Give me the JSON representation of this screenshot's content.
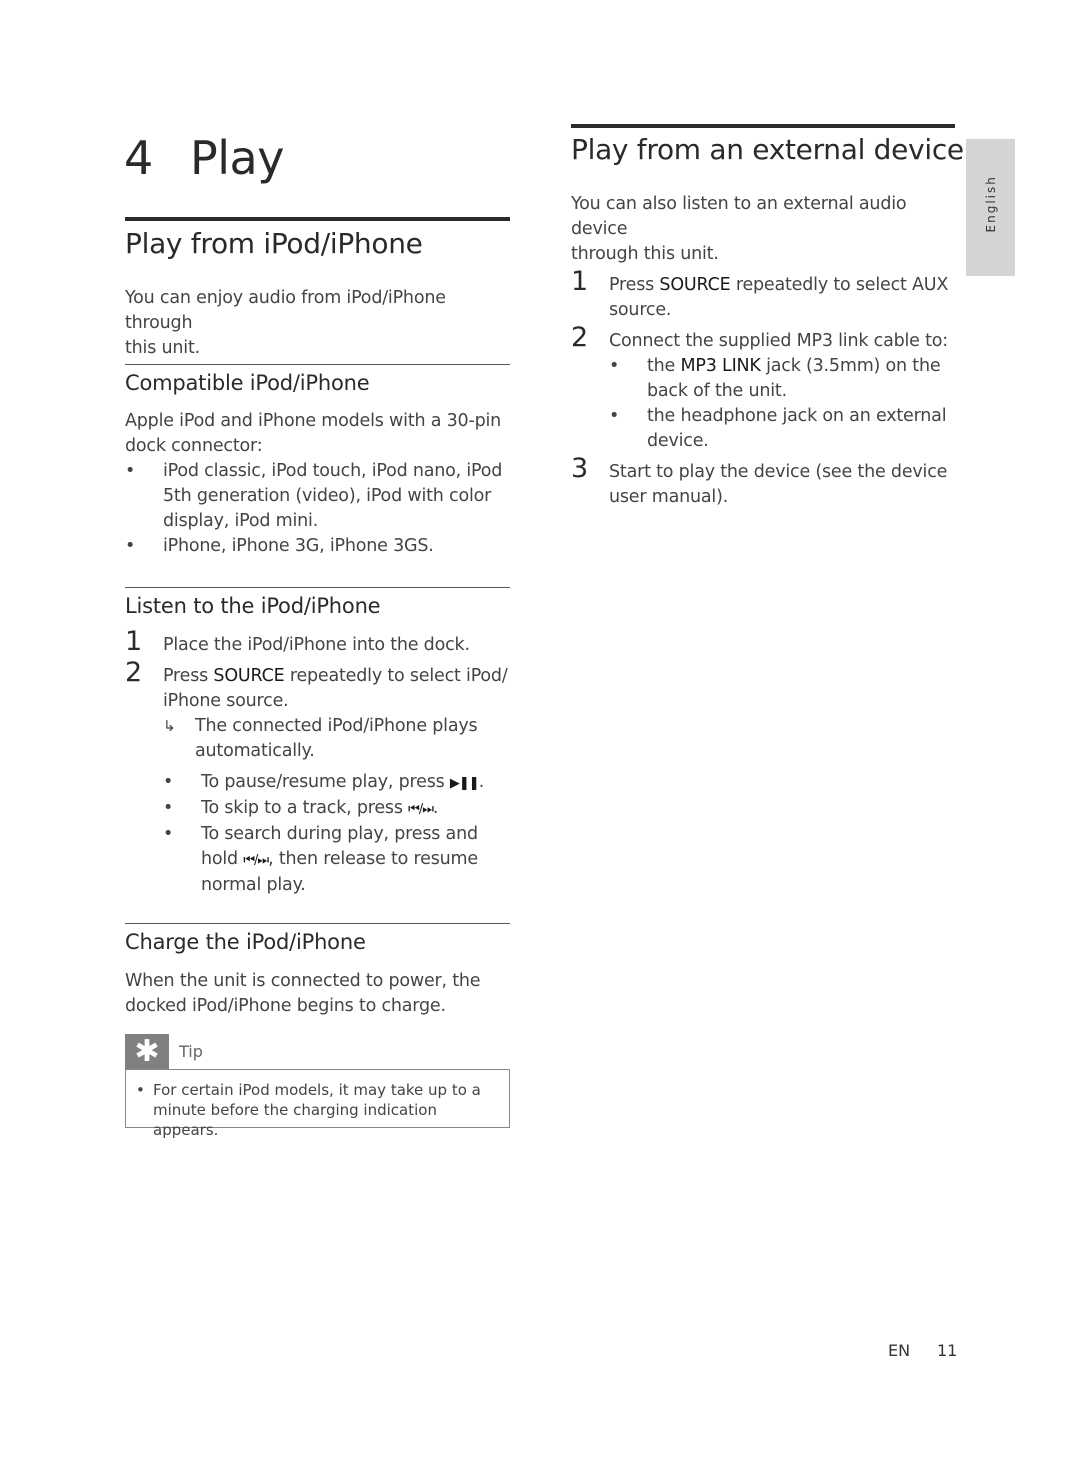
{
  "chapter": {
    "number": "4",
    "title": "Play"
  },
  "left": {
    "section_title": "Play from iPod/iPhone",
    "intro": [
      "You can enjoy audio from iPod/iPhone through",
      "this unit."
    ],
    "compatible": {
      "title": "Compatible iPod/iPhone",
      "text": [
        "Apple iPod and iPhone models with a 30-pin",
        "dock connector:"
      ],
      "bullets": [
        [
          "iPod classic, iPod touch, iPod nano, iPod",
          "5th generation (video), iPod with color",
          "display, iPod mini."
        ],
        [
          "iPhone, iPhone 3G, iPhone 3GS."
        ]
      ]
    },
    "listen": {
      "title": "Listen to the iPod/iPhone",
      "step1_num": "1",
      "step1": "Place the iPod/iPhone into the dock.",
      "step2_num": "2",
      "step2_pre": "Press ",
      "step2_key": "SOURCE",
      "step2_post": " repeatedly to select iPod/",
      "step2_line2": "iPhone source.",
      "result": [
        "The connected iPod/iPhone plays",
        "automatically."
      ],
      "bullets": {
        "pause_pre": "To pause/resume play, press ",
        "pause_sym": "▶❚❚",
        "pause_post": ".",
        "skip_pre": "To skip to a track, press ",
        "skip_sym": "⏮/⏭",
        "skip_post": ".",
        "search_line1": "To search during play, press and",
        "search_pre": "hold ",
        "search_sym": "⏮/⏭",
        "search_post": ", then release to resume",
        "search_line3": "normal play."
      }
    },
    "charge": {
      "title": "Charge the iPod/iPhone",
      "text": [
        "When the unit is connected to power, the",
        "docked iPod/iPhone begins to charge."
      ],
      "tip_label": "Tip",
      "tip_icon": "asterisk-icon",
      "tip_text": [
        "For certain iPod models, it may take up to a",
        "minute before the charging indication appears."
      ]
    }
  },
  "right": {
    "section_title": "Play from an external device",
    "intro": [
      "You can also listen to an external audio device",
      "through this unit."
    ],
    "step1_num": "1",
    "step1_pre": "Press ",
    "step1_key": "SOURCE",
    "step1_post": " repeatedly to select AUX",
    "step1_line2": "source.",
    "step2_num": "2",
    "step2": "Connect the supplied MP3 link cable to:",
    "step2_b1_pre": "the ",
    "step2_b1_key": "MP3 LINK",
    "step2_b1_post": " jack (3.5mm) on the",
    "step2_b1_line2": "back of the unit.",
    "step2_b2": [
      "the headphone jack on an external",
      "device."
    ],
    "step3_num": "3",
    "step3": [
      "Start to play the device (see the device",
      "user manual)."
    ]
  },
  "side_tab": "English",
  "footer": {
    "lang": "EN",
    "page": "11"
  }
}
